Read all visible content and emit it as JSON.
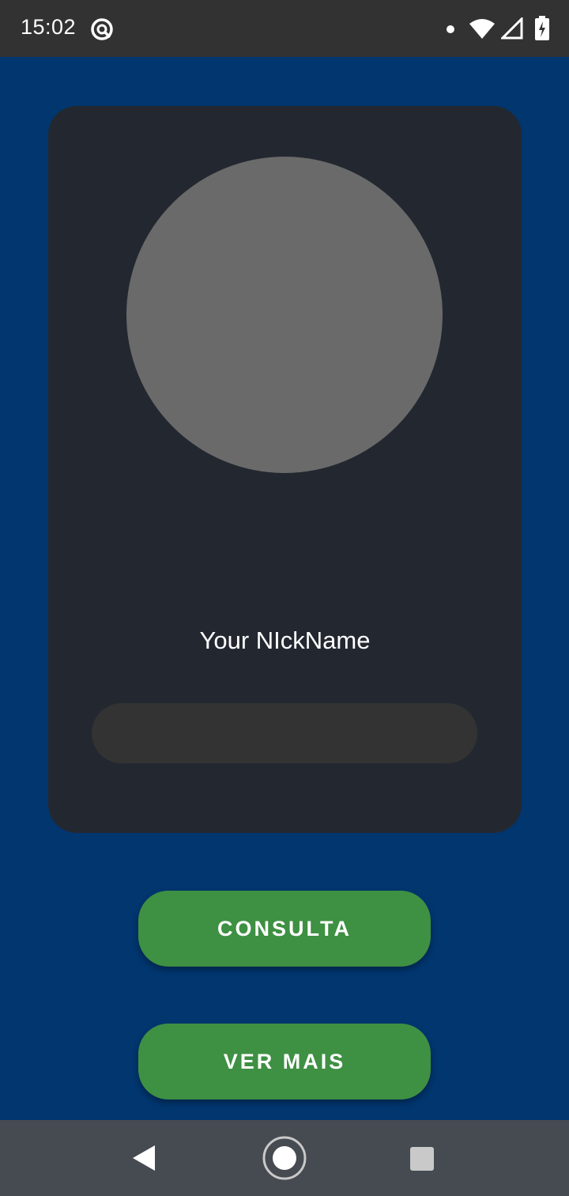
{
  "status_bar": {
    "time": "15:02",
    "icons": [
      "app-notification-icon",
      "notification-dot",
      "wifi-icon",
      "signal-icon",
      "battery-charging-icon"
    ]
  },
  "profile": {
    "nickname": "Your NIckName",
    "nickname_field_value": ""
  },
  "buttons": {
    "consulta": "CONSULTA",
    "ver_mais": "VER MAIS"
  },
  "nav_bar": {
    "icons": [
      "back-icon",
      "home-icon",
      "recents-icon"
    ]
  },
  "colors": {
    "background": "#01366f",
    "card": "#232830",
    "avatar": "#6a6a6a",
    "field": "#333333",
    "button": "#3e9043",
    "status_bar": "#323232",
    "nav_bar": "#464b51"
  }
}
